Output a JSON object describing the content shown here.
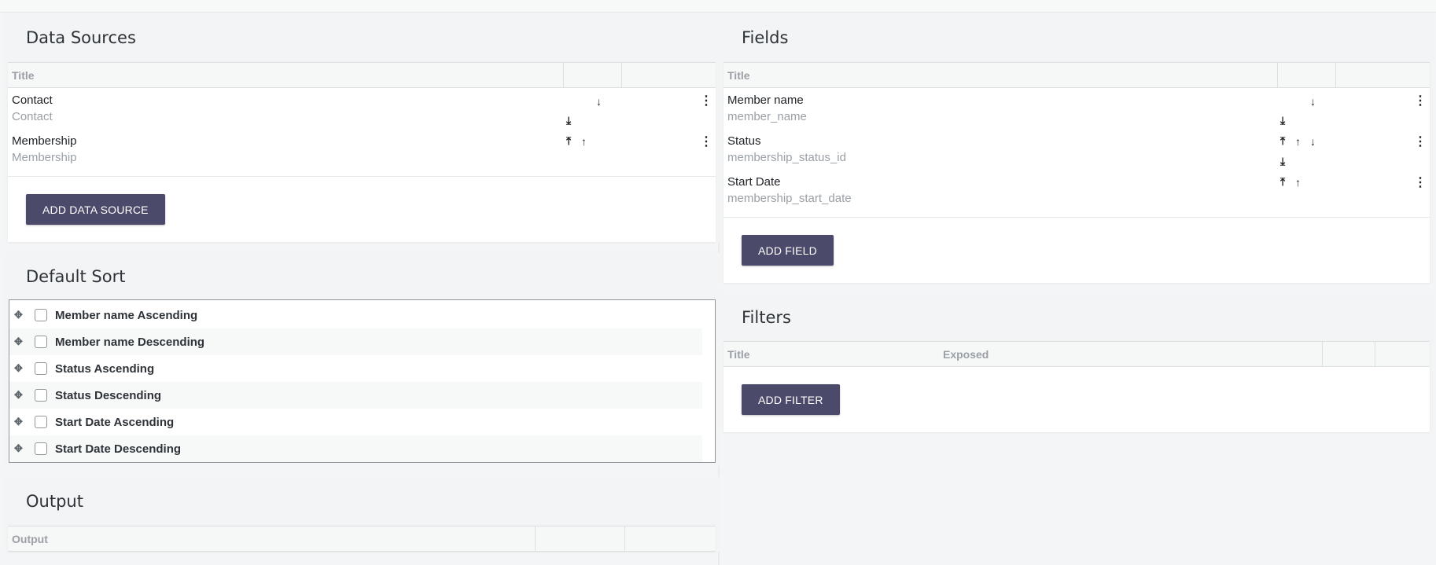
{
  "data_sources": {
    "title": "Data Sources",
    "col_title": "Title",
    "rows": [
      {
        "title": "Contact",
        "subtitle": "Contact"
      },
      {
        "title": "Membership",
        "subtitle": "Membership"
      }
    ],
    "add_label": "ADD DATA SOURCE"
  },
  "default_sort": {
    "title": "Default Sort",
    "items": [
      {
        "label": "Member name Ascending"
      },
      {
        "label": "Member name Descending"
      },
      {
        "label": "Status Ascending"
      },
      {
        "label": "Status Descending"
      },
      {
        "label": "Start Date Ascending"
      },
      {
        "label": "Start Date Descending"
      }
    ]
  },
  "output": {
    "title": "Output",
    "col_output": "Output"
  },
  "fields": {
    "title": "Fields",
    "col_title": "Title",
    "rows": [
      {
        "title": "Member name",
        "subtitle": "member_name"
      },
      {
        "title": "Status",
        "subtitle": "membership_status_id"
      },
      {
        "title": "Start Date",
        "subtitle": "membership_start_date"
      }
    ],
    "add_label": "ADD FIELD"
  },
  "filters": {
    "title": "Filters",
    "col_title": "Title",
    "col_exposed": "Exposed",
    "add_label": "ADD FILTER"
  },
  "icons": {
    "move_down": "arrow-down-icon",
    "move_up": "arrow-up-icon",
    "move_top": "move-to-top-icon",
    "move_bottom": "move-to-bottom-icon",
    "menu": "kebab-menu-icon",
    "drag": "drag-handle-icon"
  },
  "colors": {
    "button_bg": "#4b4a6b",
    "section_bg": "#f3f4f5",
    "muted_text": "#9aa0a6"
  }
}
